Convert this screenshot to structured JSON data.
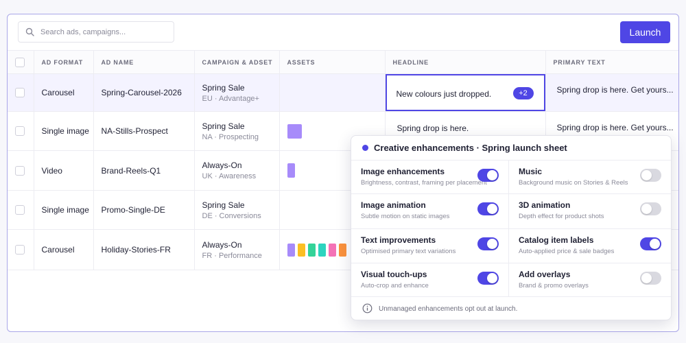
{
  "search": {
    "placeholder": "Search ads, campaigns..."
  },
  "toolbar": {
    "launch_label": "Launch"
  },
  "table": {
    "headers": [
      "AD FORMAT",
      "AD NAME",
      "CAMPAIGN & ADSET",
      "ASSETS",
      "HEADLINE",
      "PRIMARY TEXT"
    ],
    "rows": [
      {
        "format": "Carousel",
        "name": "Spring-Carousel-2026",
        "campaign": "Spring Sale",
        "adset": "EU · Advantage+",
        "headline": "New colours just dropped.",
        "headline_extra": "+2",
        "primary_text": "Spring drop is here. Get yours..."
      },
      {
        "format": "Single image",
        "name": "NA-Stills-Prospect",
        "campaign": "Spring Sale",
        "adset": "NA · Prospecting",
        "headline": "Spring drop is here.",
        "primary_text": "Spring drop is here. Get yours..."
      },
      {
        "format": "Video",
        "name": "Brand-Reels-Q1",
        "campaign": "Always-On",
        "adset": "UK · Awareness"
      },
      {
        "format": "Single image",
        "name": "Promo-Single-DE",
        "campaign": "Spring Sale",
        "adset": "DE · Conversions"
      },
      {
        "format": "Carousel",
        "name": "Holiday-Stories-FR",
        "campaign": "Always-On",
        "adset": "FR · Performance"
      }
    ],
    "asset_colors": {
      "row2": [
        "#a78bfa"
      ],
      "row3": [
        "#a78bfa"
      ],
      "row5": [
        "#a78bfa",
        "#fbbf24",
        "#34d399",
        "#2dd4bf",
        "#f472b6",
        "#fb923c"
      ]
    }
  },
  "panel": {
    "title": "Creative enhancements · Spring launch sheet",
    "items": [
      {
        "label": "Image enhancements",
        "desc": "Brightness, contrast, framing per placement",
        "on": true
      },
      {
        "label": "Music",
        "desc": "Background music on Stories & Reels",
        "on": false
      },
      {
        "label": "Image animation",
        "desc": "Subtle motion on static images",
        "on": true
      },
      {
        "label": "3D animation",
        "desc": "Depth effect for product shots",
        "on": false
      },
      {
        "label": "Text improvements",
        "desc": "Optimised primary text variations",
        "on": true
      },
      {
        "label": "Catalog item labels",
        "desc": "Auto-applied price & sale badges",
        "on": true
      },
      {
        "label": "Visual touch-ups",
        "desc": "Auto-crop and enhance",
        "on": true
      },
      {
        "label": "Add overlays",
        "desc": "Brand & promo overlays",
        "on": false
      }
    ],
    "footer": "Unmanaged enhancements opt out at launch."
  },
  "colors": {
    "accent": "#4f46e5",
    "selected_row": "#f4f3ff"
  },
  "icons": {
    "search": "search-icon",
    "info": "info-icon",
    "status": "status-dot-icon"
  }
}
